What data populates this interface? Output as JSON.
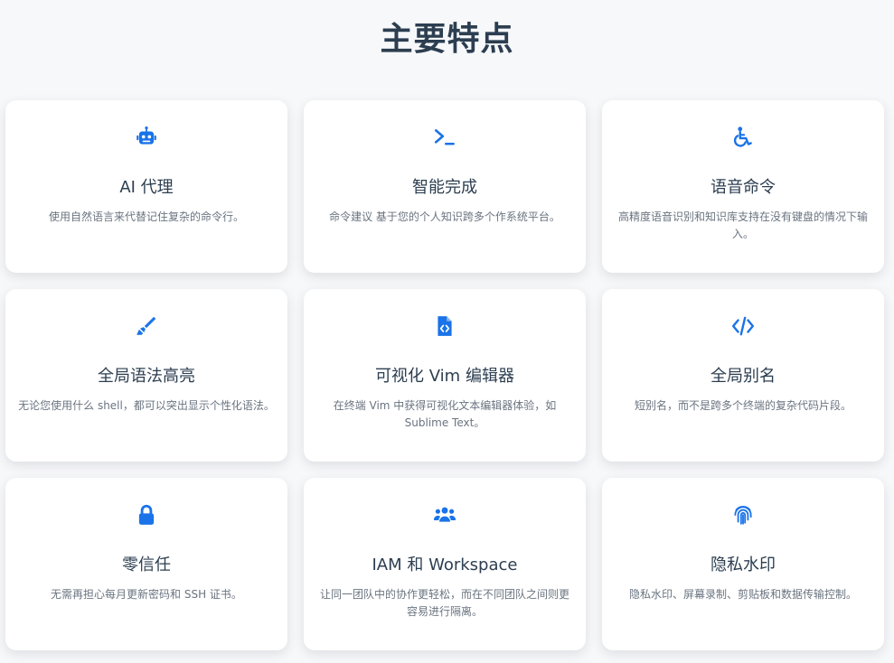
{
  "page": {
    "title": "主要特点"
  },
  "colors": {
    "accent": "#1a73e8",
    "title": "#2c3e50",
    "text": "#6a7480",
    "background": "#f7f8fa"
  },
  "features": [
    {
      "icon": "robot-icon",
      "title": "AI 代理",
      "description": "使用自然语言来代替记住复杂的命令行。"
    },
    {
      "icon": "terminal-icon",
      "title": "智能完成",
      "description": "命令建议 基于您的个人知识跨多个作系统平台。"
    },
    {
      "icon": "wheelchair-icon",
      "title": "语音命令",
      "description": "高精度语音识别和知识库支持在没有键盘的情况下输入。"
    },
    {
      "icon": "highlighter-icon",
      "title": "全局语法高亮",
      "description": "无论您使用什么 shell，都可以突出显示个性化语法。"
    },
    {
      "icon": "file-code-icon",
      "title": "可视化 Vim 编辑器",
      "description": "在终端 Vim 中获得可视化文本编辑器体验，如 Sublime Text。"
    },
    {
      "icon": "code-icon",
      "title": "全局别名",
      "description": "短别名，而不是跨多个终端的复杂代码片段。"
    },
    {
      "icon": "lock-icon",
      "title": "零信任",
      "description": "无需再担心每月更新密码和 SSH 证书。"
    },
    {
      "icon": "users-icon",
      "title": "IAM 和 Workspace",
      "description": "让同一团队中的协作更轻松，而在不同团队之间则更容易进行隔离。"
    },
    {
      "icon": "fingerprint-icon",
      "title": "隐私水印",
      "description": "隐私水印、屏幕录制、剪贴板和数据传输控制。"
    }
  ]
}
